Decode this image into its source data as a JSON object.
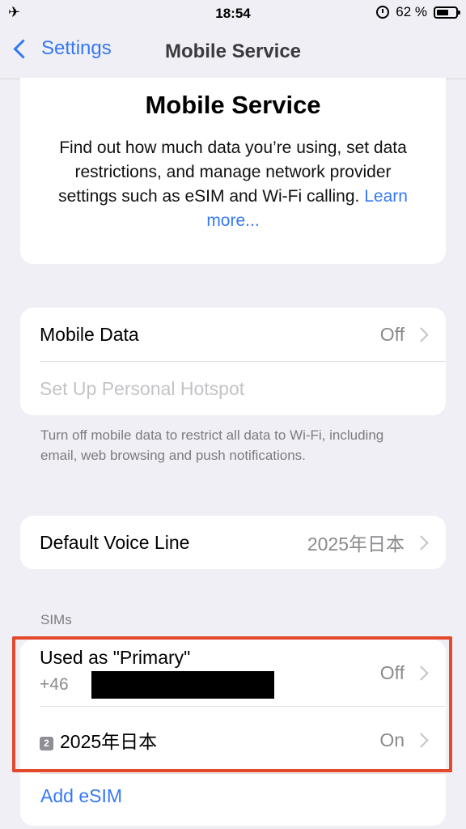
{
  "status_bar": {
    "time": "18:54",
    "battery": "62 %",
    "battery_level": 0.62
  },
  "nav": {
    "back_label": "Settings",
    "title": "Mobile Service"
  },
  "hero": {
    "title": "Mobile Service",
    "description": "Find out how much data you’re using, set data restrictions, and manage network provider settings such as eSIM and Wi-Fi calling.",
    "link": "Learn more..."
  },
  "data_group": {
    "mobile_data_label": "Mobile Data",
    "mobile_data_value": "Off",
    "hotspot_label": "Set Up Personal Hotspot",
    "note": "Turn off mobile data to restrict all data to Wi-Fi, including email, web browsing and push notifications."
  },
  "voice": {
    "label": "Default Voice Line",
    "value": "2025年日本"
  },
  "sims": {
    "header": "SIMs",
    "primary_title": "Used as \"Primary\"",
    "primary_number": "+46",
    "primary_value": "Off",
    "secondary_badge": "2",
    "secondary_title": "2025年日本",
    "secondary_value": "On",
    "add_esim": "Add eSIM"
  },
  "colors": {
    "accent": "#3478f6",
    "highlight": "#e24a2e",
    "background": "#f0eff5"
  }
}
